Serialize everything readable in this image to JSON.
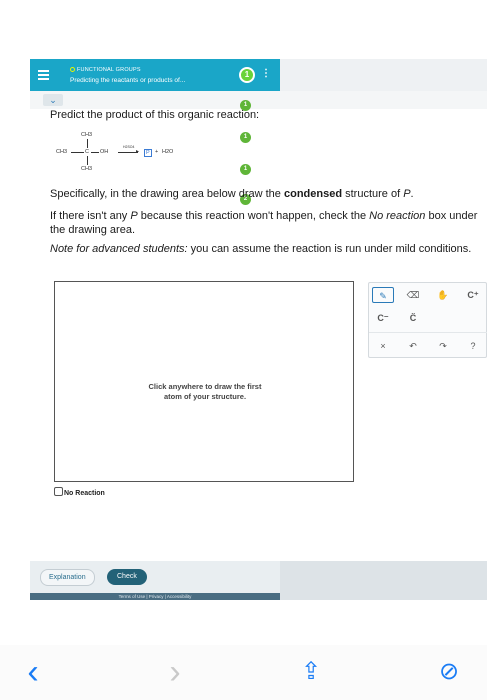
{
  "header": {
    "topic": "FUNCTIONAL GROUPS",
    "title": "Predicting the reactants or products of...",
    "progress": "1",
    "menu_glyph": "⋮"
  },
  "markers": [
    "1",
    "1",
    "2",
    "1"
  ],
  "question": {
    "prompt": "Predict the product of this organic reaction:",
    "reaction": {
      "top_methyl": "CH3",
      "left_methyl": "CH3",
      "carbon": "C",
      "hydroxyl": "OH",
      "bottom_methyl": "CH3",
      "arrow_label": "H2SO4",
      "product": "P",
      "plus": "+",
      "water": "H2O"
    },
    "instr1_before": "Specifically, in the drawing area below draw the ",
    "instr1_bold": "condensed",
    "instr1_after": " structure of ",
    "instr1_p": "P",
    "instr1_end": ".",
    "instr2_a": "If there isn't any ",
    "instr2_p": "P",
    "instr2_b": " because this reaction won't happen, check the ",
    "instr2_em": "No reaction",
    "instr2_c": " box under the drawing area.",
    "instr3_em": "Note for advanced students:",
    "instr3_rest": " you can assume the reaction is run under mild conditions."
  },
  "canvas": {
    "hint": "Click anywhere to draw the first\natom of your structure."
  },
  "tools": {
    "pencil": "✎",
    "eraser": "⌫",
    "hand": "✋",
    "cation": "C⁺",
    "anion": "C⁻",
    "radical": "C̈",
    "clear": "×",
    "undo": "↶",
    "redo": "↷",
    "help": "?"
  },
  "no_reaction_label": "No Reaction",
  "footer": {
    "explanation": "Explanation",
    "check": "Check",
    "terms": "Terms of Use  |  Privacy  |  Accessibility"
  },
  "browser_nav": {
    "back": "‹",
    "forward": "›",
    "share": "⇪",
    "compass": "⊘"
  },
  "colors": {
    "header_teal": "#1aa6c8",
    "check_button": "#236278",
    "marker_green": "#5fb538",
    "ios_blue": "#1a7cf5"
  }
}
